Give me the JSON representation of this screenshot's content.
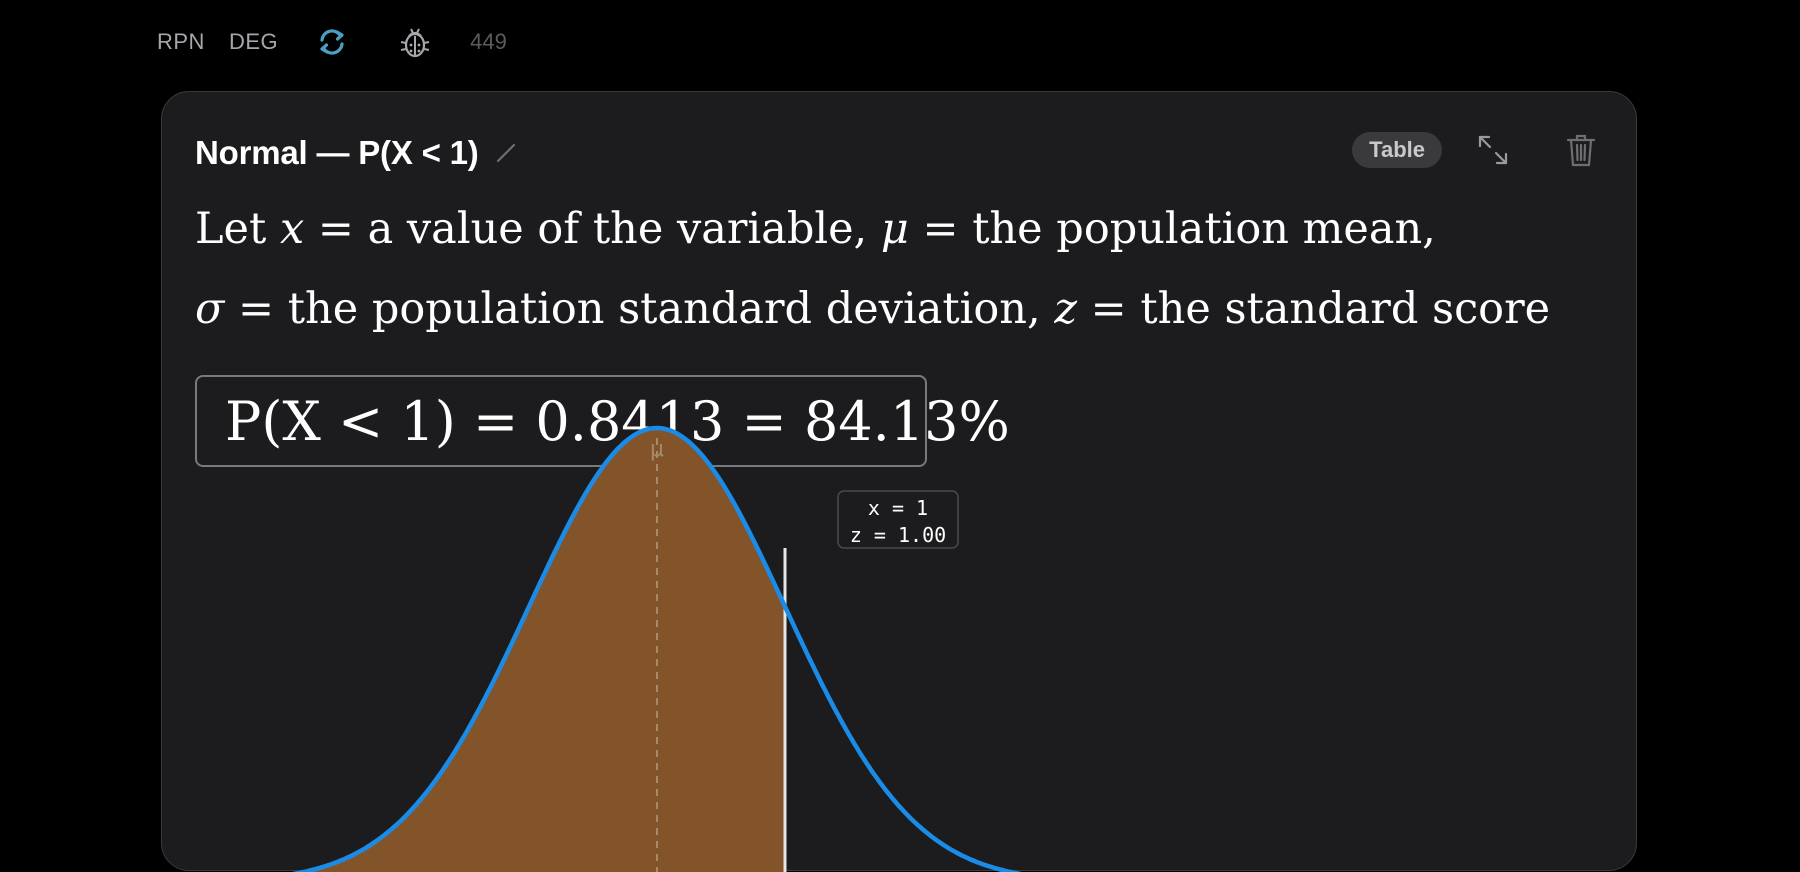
{
  "topbar": {
    "mode": "RPN",
    "angle_unit": "DEG",
    "count": "449",
    "icons": {
      "sync": "sync-icon",
      "debug": "bug-icon"
    }
  },
  "card": {
    "title": "Normal — P(X < 1)",
    "table_label": "Table",
    "icons": {
      "edit": "pencil-icon",
      "expand": "expand-icon",
      "delete": "trash-icon"
    },
    "description": {
      "line1": {
        "let": "Let ",
        "x_var": "x",
        "x_def": " = a value of the variable, ",
        "mu_var": "μ",
        "mu_def": " = the population mean,"
      },
      "line2": {
        "sigma_var": "σ",
        "sigma_def": " = the population standard deviation, ",
        "z_var": "z",
        "z_def": " = the standard score"
      }
    },
    "result": "P(X < 1) = 0.8413 = 84.13%"
  },
  "chart_data": {
    "type": "area",
    "distribution": "normal",
    "mean_label": "μ",
    "x_value": 1,
    "z_value": 1.0,
    "probability": 0.8413,
    "marker_label": {
      "x_line": "x = 1",
      "z_line": "z = 1.00"
    },
    "shaded_region": "left-of-x",
    "colors": {
      "curve": "#1a8ce8",
      "fill": "#83542a",
      "marker": "#e6e6e6",
      "mean_line": "#a38a6a"
    }
  },
  "colors": {
    "background": "#000000",
    "card": "#1c1c1e",
    "accent": "#4a9fc4"
  }
}
